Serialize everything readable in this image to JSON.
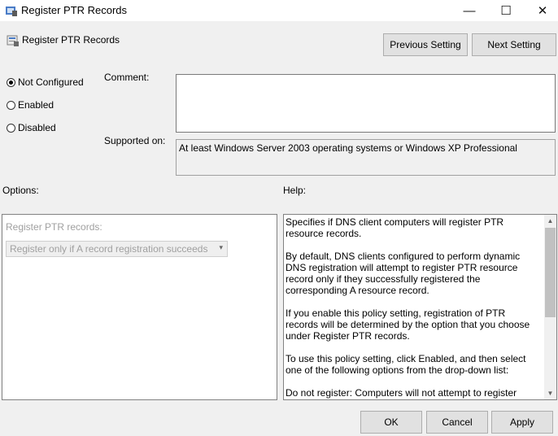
{
  "window": {
    "title": "Register PTR Records",
    "controls": {
      "minimize": "—",
      "maximize": "☐",
      "close": "✕"
    }
  },
  "header": {
    "title": "Register PTR Records"
  },
  "nav": {
    "previous_label": "Previous Setting",
    "next_label": "Next Setting"
  },
  "state": {
    "options": [
      {
        "label": "Not Configured",
        "selected": true
      },
      {
        "label": "Enabled",
        "selected": false
      },
      {
        "label": "Disabled",
        "selected": false
      }
    ]
  },
  "comment": {
    "label": "Comment:",
    "value": ""
  },
  "supported": {
    "label": "Supported on:",
    "value": "At least Windows Server 2003 operating systems or Windows XP Professional"
  },
  "options_panel": {
    "label": "Options:",
    "field_label": "Register PTR records:",
    "select_value": "Register only if A record registration succeeds"
  },
  "help_panel": {
    "label": "Help:",
    "paragraphs": [
      "Specifies if DNS client computers will register PTR resource records.",
      "By default, DNS clients configured to perform dynamic DNS registration will attempt to register PTR resource record only if they successfully registered the corresponding A resource record.",
      "If you enable this policy setting, registration of PTR records will be determined by the option that you choose under Register PTR records.",
      "To use this policy setting, click Enabled, and then select one of the following options from the drop-down list:",
      "Do not register: Computers will not attempt to register PTR"
    ]
  },
  "footer": {
    "ok_label": "OK",
    "cancel_label": "Cancel",
    "apply_label": "Apply"
  }
}
